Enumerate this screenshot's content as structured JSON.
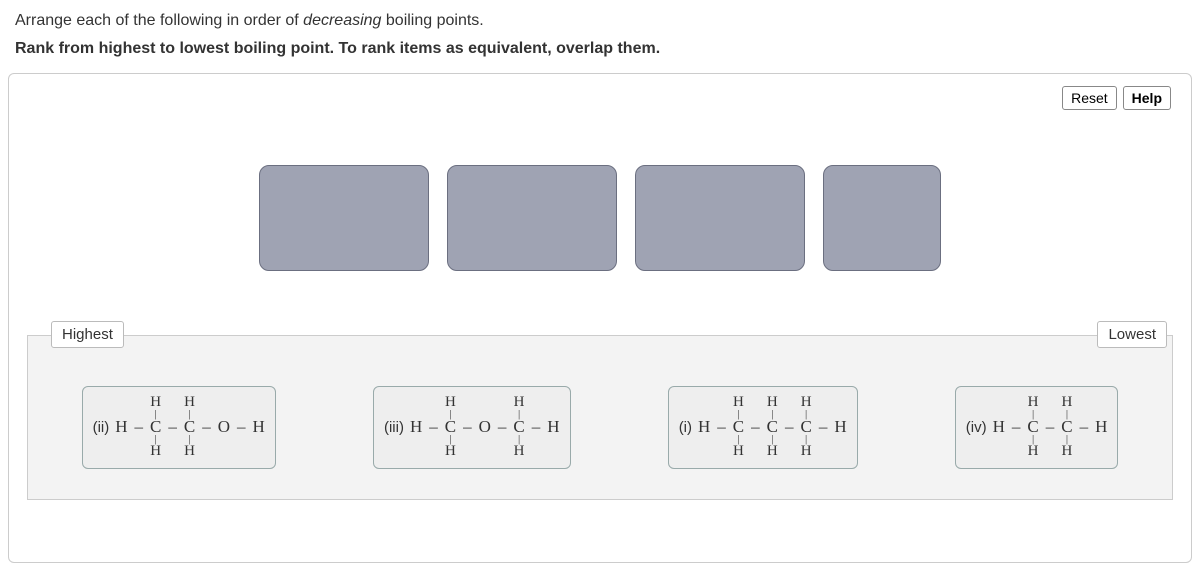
{
  "question": {
    "line1_pre": "Arrange each of the following in order of ",
    "line1_em": "decreasing",
    "line1_post": " boiling points.",
    "line2": "Rank from highest to lowest boiling point. To rank items as equivalent, overlap them."
  },
  "buttons": {
    "reset": "Reset",
    "help": "Help"
  },
  "rank": {
    "highLabel": "Highest",
    "lowLabel": "Lowest"
  },
  "items": {
    "ii": {
      "rn": "(ii)",
      "prefix": "H",
      "carbons": [
        "C",
        "C"
      ],
      "suffix": [
        "O",
        "H"
      ]
    },
    "iii": {
      "rn": "(iii)",
      "prefix": "H",
      "carbons_split": {
        "left": "C",
        "mid": "O",
        "right": "C"
      },
      "suffix": [
        "H"
      ]
    },
    "i": {
      "rn": "(i)",
      "prefix": "H",
      "carbons": [
        "C",
        "C",
        "C"
      ],
      "suffix": [
        "H"
      ]
    },
    "iv": {
      "rn": "(iv)",
      "prefix": "H",
      "carbons": [
        "C",
        "C"
      ],
      "suffix": [
        "H"
      ]
    }
  },
  "glyphs": {
    "H": "H",
    "C": "C",
    "O": "O",
    "pipe": "|",
    "dash": "–"
  }
}
